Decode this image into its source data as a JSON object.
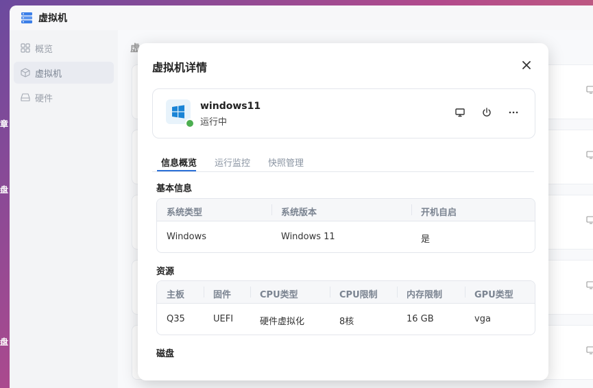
{
  "app": {
    "title": "虚拟机"
  },
  "sidebar": {
    "items": [
      {
        "label": "概览",
        "icon": "grid-icon"
      },
      {
        "label": "虚拟机",
        "icon": "cube-icon",
        "active": true
      },
      {
        "label": "硬件",
        "icon": "drive-icon"
      }
    ]
  },
  "content": {
    "heading_partial": "虚"
  },
  "modal": {
    "title": "虚拟机详情",
    "vm": {
      "name": "windows11",
      "status": "运行中",
      "status_color": "#4cae50"
    },
    "actions": [
      "monitor-icon",
      "power-icon",
      "more-icon"
    ],
    "tabs": [
      {
        "label": "信息概览",
        "active": true
      },
      {
        "label": "运行监控"
      },
      {
        "label": "快照管理"
      }
    ],
    "basic_info": {
      "title": "基本信息",
      "headers": [
        "系统类型",
        "系统版本",
        "开机自启"
      ],
      "values": [
        "Windows",
        "Windows 11",
        "是"
      ]
    },
    "resources": {
      "title": "资源",
      "headers": [
        "主板",
        "固件",
        "CPU类型",
        "CPU限制",
        "内存限制",
        "GPU类型"
      ],
      "values": [
        "Q35",
        "UEFI",
        "硬件虚拟化",
        "8核",
        "16 GB",
        "vga"
      ]
    },
    "disk": {
      "title": "磁盘"
    }
  },
  "colors": {
    "accent": "#2a6fd6",
    "running": "#4cae50"
  }
}
